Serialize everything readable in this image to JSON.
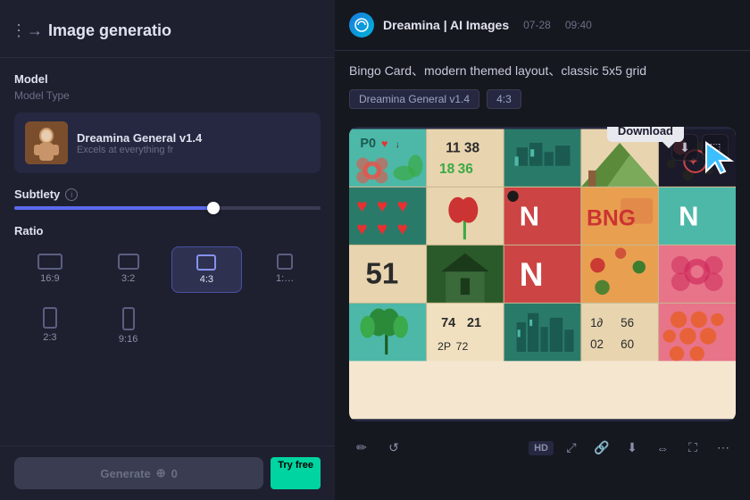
{
  "left_panel": {
    "header_icon": "→",
    "title": "Image generatio",
    "model_section": {
      "label": "Model",
      "sub": "Model Type"
    },
    "model_card": {
      "name": "Dreamina General v1.4",
      "desc": "Excels at everything fr"
    },
    "subtlety": {
      "label": "Subtlety",
      "slider_pct": 65
    },
    "ratio": {
      "label": "Ratio",
      "options": [
        {
          "id": "16:9",
          "w": 28,
          "h": 18
        },
        {
          "id": "3:2",
          "w": 24,
          "h": 18
        },
        {
          "id": "4:3",
          "w": 22,
          "h": 18,
          "active": true
        },
        {
          "id": "1:…",
          "w": 18,
          "h": 18
        }
      ],
      "options2": [
        {
          "id": "2:3",
          "w": 16,
          "h": 24
        },
        {
          "id": "9:16",
          "w": 14,
          "h": 26
        },
        {
          "id": "",
          "w": 0,
          "h": 0
        },
        {
          "id": "",
          "w": 0,
          "h": 0
        }
      ]
    },
    "generate": {
      "label": "Generate",
      "icon": "+",
      "count": "0",
      "try_free": "Try free"
    }
  },
  "right_panel": {
    "app_name": "Dreamina | AI Images",
    "date": "07-28",
    "time": "09:40",
    "description": "Bingo Card、modern themed layout、classic 5x5 grid",
    "tags": [
      "Dreamina General v1.4",
      "4:3"
    ],
    "download_tooltip": "Download",
    "toolbar": {
      "hd": "HD",
      "icons": [
        "✏️",
        "↺",
        "↓",
        "📋",
        "⇔",
        "⛶",
        "🔗",
        "⋯"
      ]
    }
  }
}
